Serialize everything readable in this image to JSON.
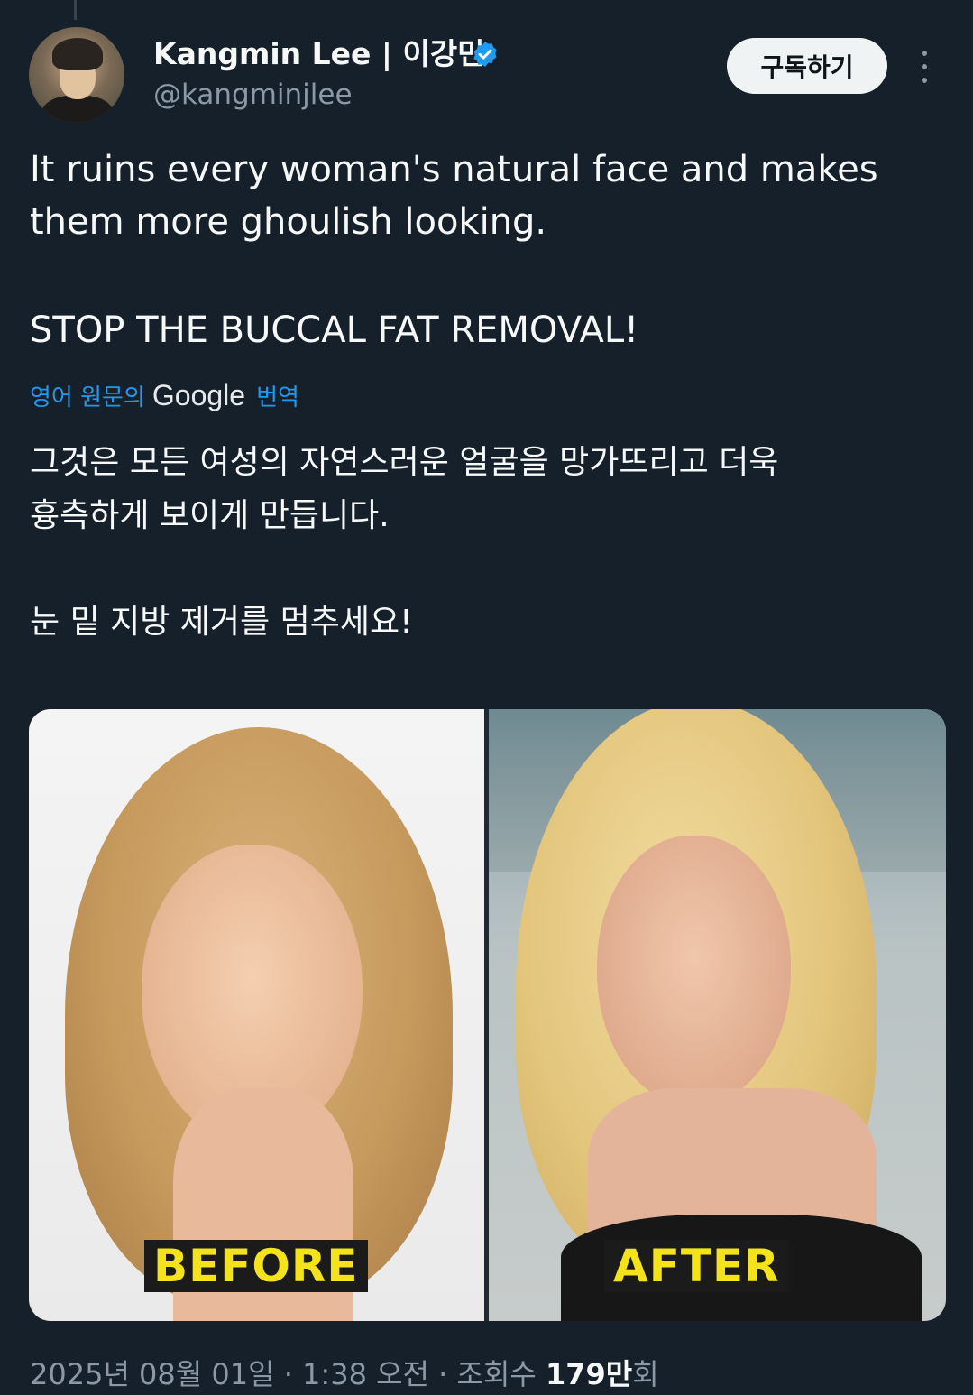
{
  "tweet": {
    "author_name": "Kangmin Lee | 이강민",
    "handle": "@kangminjlee",
    "subscribe_label": "구독하기",
    "text_line1": "It ruins every woman's natural face and makes\nthem more ghoulish looking.",
    "text_line2": "STOP THE BUCCAL FAT REMOVAL!",
    "translate_prefix": "영어 원문의",
    "translate_brand": "Google",
    "translate_suffix": "번역",
    "translated_line1": "그것은 모든 여성의 자연스러운 얼굴을 망가뜨리고 더욱\n흉측하게 보이게 만듭니다.",
    "translated_line2": "눈 밑 지방 제거를 멈추세요!",
    "media_labels": {
      "before": "BEFORE",
      "after": "AFTER"
    },
    "meta": {
      "date": "2025년 08월 01일",
      "time": "1:38 오전",
      "views_label": "조회수",
      "views_value": "179만",
      "views_suffix": "회"
    }
  },
  "colors": {
    "background": "#15202b",
    "accent": "#1d9bf0",
    "muted": "#8b98a5",
    "label_text": "#f4e21a"
  },
  "icons": [
    "verified-badge-icon",
    "more-options-icon"
  ]
}
